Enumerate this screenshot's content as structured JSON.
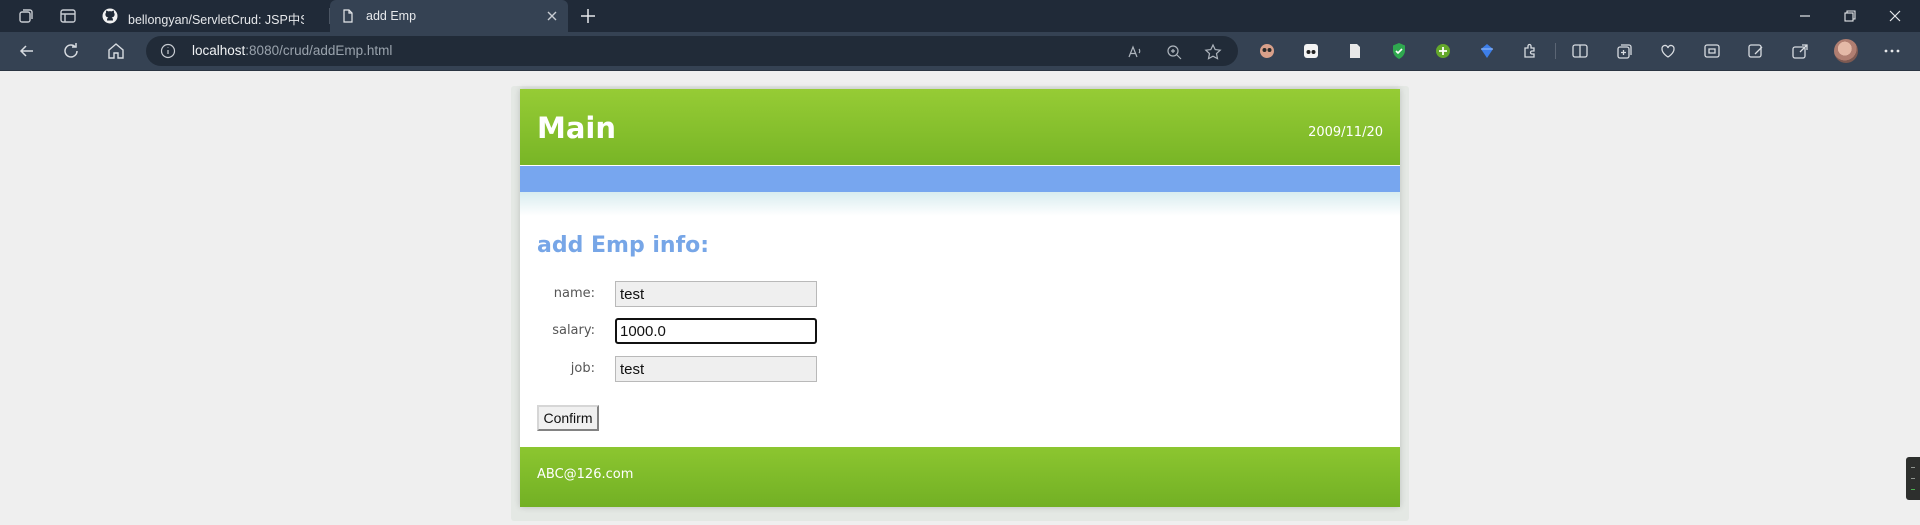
{
  "browser": {
    "tabs": [
      {
        "title": "bellongyan/ServletCrud: JSP中Servlet CRUD",
        "active": false
      },
      {
        "title": "add Emp",
        "active": true
      }
    ],
    "url_host": "localhost",
    "url_rest": ":8080/crud/addEmp.html",
    "accent_color": "#354253"
  },
  "page": {
    "logo": "Main",
    "date": "2009/11/20",
    "form_title": "add Emp info:",
    "fields": [
      {
        "label": "name:",
        "value": "test"
      },
      {
        "label": "salary:",
        "value": "1000.0"
      },
      {
        "label": "job:",
        "value": "test"
      }
    ],
    "confirm_label": "Confirm",
    "footer_text": "ABC@126.com",
    "colors": {
      "header": "#84c22e",
      "navbar": "#77a6ef",
      "title": "#77a6e7"
    }
  }
}
